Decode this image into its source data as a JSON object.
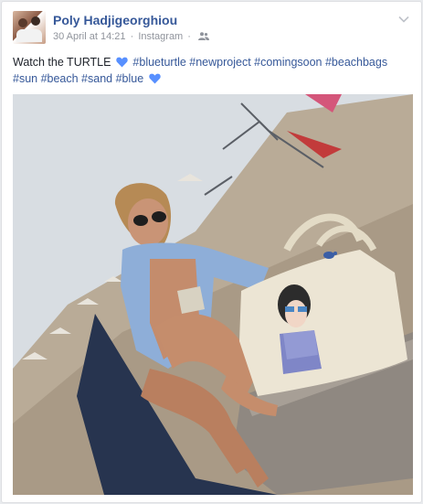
{
  "post": {
    "author_name": "Poly Hadjigeorghiou",
    "timestamp": "30 April at 14:21",
    "separator": "·",
    "source": "Instagram",
    "separator2": "·",
    "audience_icon": "friends-icon",
    "menu_icon": "chevron-down-icon",
    "text_lead": "Watch the TURTLE",
    "hashtags_line1": "#blueturtle #newproject #comingsoon #beachbags",
    "hashtags_line2": "#sun #beach #sand #blue",
    "heart_color": "#5890ff"
  },
  "colors": {
    "link": "#365899",
    "meta": "#90949c",
    "text": "#1d2129"
  }
}
